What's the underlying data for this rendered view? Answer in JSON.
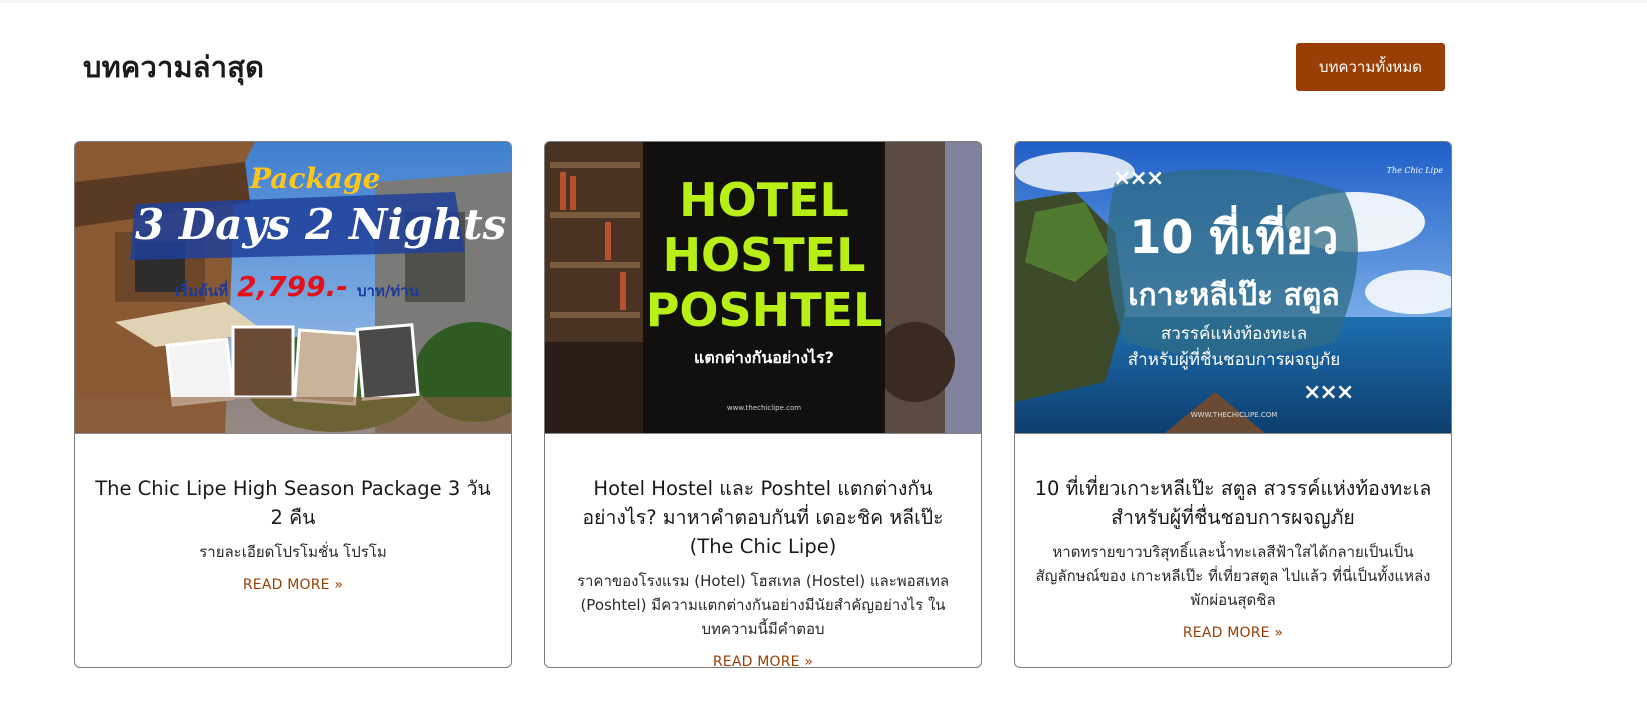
{
  "section": {
    "heading": "บทความล่าสุด",
    "all_button_label": "บทความทั้งหมด"
  },
  "posts": [
    {
      "thumb": {
        "script_title": "Package",
        "headline": "3 Days 2 Nights",
        "price_prefix": "เริ่มต้นที่",
        "price": "2,799.-",
        "price_suffix": "บาท/ท่าน"
      },
      "title": "The Chic Lipe High Season Package 3 วัน 2 คืน",
      "excerpt": "รายละเอียดโปรโมชั่น โปรโม",
      "read_more": "READ MORE »"
    },
    {
      "thumb": {
        "line1": "HOTEL",
        "line2": "HOSTEL",
        "line3": "POSHTEL",
        "subtitle": "แตกต่างกันอย่างไร?",
        "website": "www.thechiclipe.com"
      },
      "title": "Hotel Hostel และ Poshtel แตกต่างกันอย่างไร? มาหาคำตอบกันที่ เดอะชิค หลีเป๊ะ (The Chic Lipe)",
      "excerpt": "ราคาของโรงแรม (Hotel) โฮสเทล (Hostel) และพอสเทล (Poshtel) มีความแตกต่างกันอย่างมีนัยสำคัญอย่างไร ในบทความนี้มีคำตอบ",
      "read_more": "READ MORE »"
    },
    {
      "thumb": {
        "headline": "10 ที่เที่ยว",
        "place": "เกาะหลีเป๊ะ สตูล",
        "line1": "สวรรค์แห่งท้องทะเล",
        "line2": "สำหรับผู้ที่ชื่นชอบการผจญภัย",
        "brand": "The Chic Lipe",
        "website": "WWW.THECHICLIPE.COM",
        "marks": "×××"
      },
      "title": "10 ที่เที่ยวเกาะหลีเป๊ะ สตูล สวรรค์แห่งท้องทะเล สำหรับผู้ที่ชื่นชอบการผจญภัย",
      "excerpt": "หาดทรายขาวบริสุทธิ์และน้ำทะเลสีฟ้าใสได้กลายเป็นเป็นสัญลักษณ์ของ เกาะหลีเป๊ะ ที่เที่ยวสตูล ไปแล้ว ที่นี่เป็นทั้งแหล่งพักผ่อนสุดชิล",
      "read_more": "READ MORE »"
    }
  ]
}
